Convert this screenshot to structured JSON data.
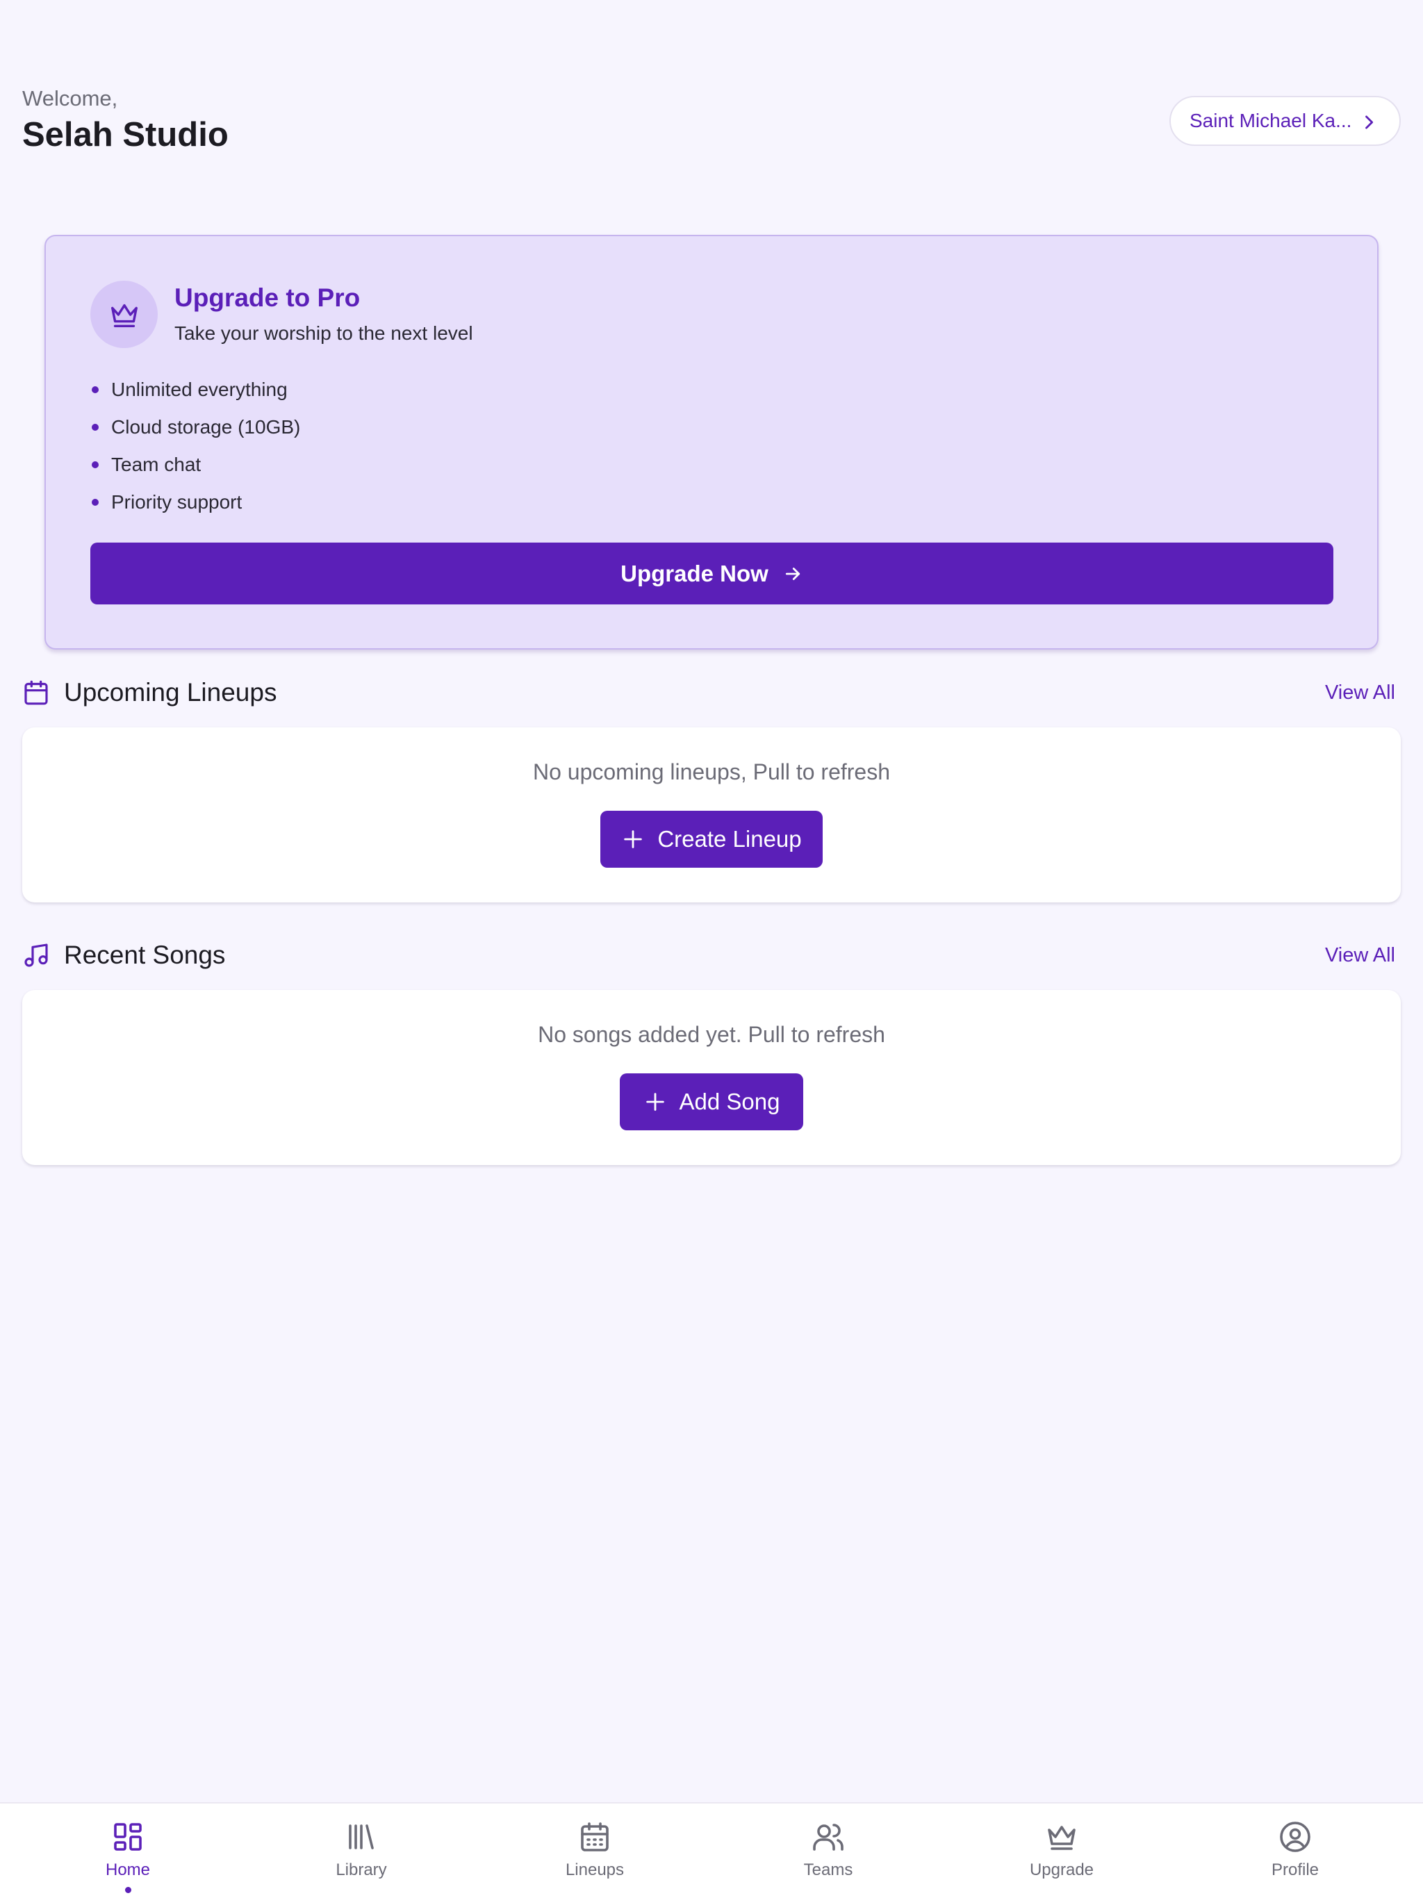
{
  "header": {
    "welcome": "Welcome,",
    "username": "Selah Studio",
    "church_name": "Saint Michael Ka..."
  },
  "pro_card": {
    "title": "Upgrade to Pro",
    "subtitle": "Take your worship to the next level",
    "features": [
      "Unlimited everything",
      "Cloud storage (10GB)",
      "Team chat",
      "Priority support"
    ],
    "button_label": "Upgrade Now",
    "icon": "crown-icon"
  },
  "lineups": {
    "title": "Upcoming Lineups",
    "view_all": "View All",
    "empty_message": "No upcoming lineups, Pull to refresh",
    "action_label": "Create Lineup",
    "icon": "calendar-icon"
  },
  "songs": {
    "title": "Recent Songs",
    "view_all": "View All",
    "empty_message": "No songs added yet. Pull to refresh",
    "action_label": "Add Song",
    "icon": "music-note-icon"
  },
  "nav": {
    "items": [
      {
        "label": "Home",
        "icon": "grid-icon",
        "active": true
      },
      {
        "label": "Library",
        "icon": "library-icon",
        "active": false
      },
      {
        "label": "Lineups",
        "icon": "calendar-icon",
        "active": false
      },
      {
        "label": "Teams",
        "icon": "users-icon",
        "active": false
      },
      {
        "label": "Upgrade",
        "icon": "crown-icon",
        "active": false
      },
      {
        "label": "Profile",
        "icon": "user-circle-icon",
        "active": false
      }
    ]
  },
  "colors": {
    "accent": "#5b1fb8",
    "background": "#f7f5fe",
    "pro_card_bg": "#e7dffb",
    "muted_text": "#6b6b76"
  }
}
